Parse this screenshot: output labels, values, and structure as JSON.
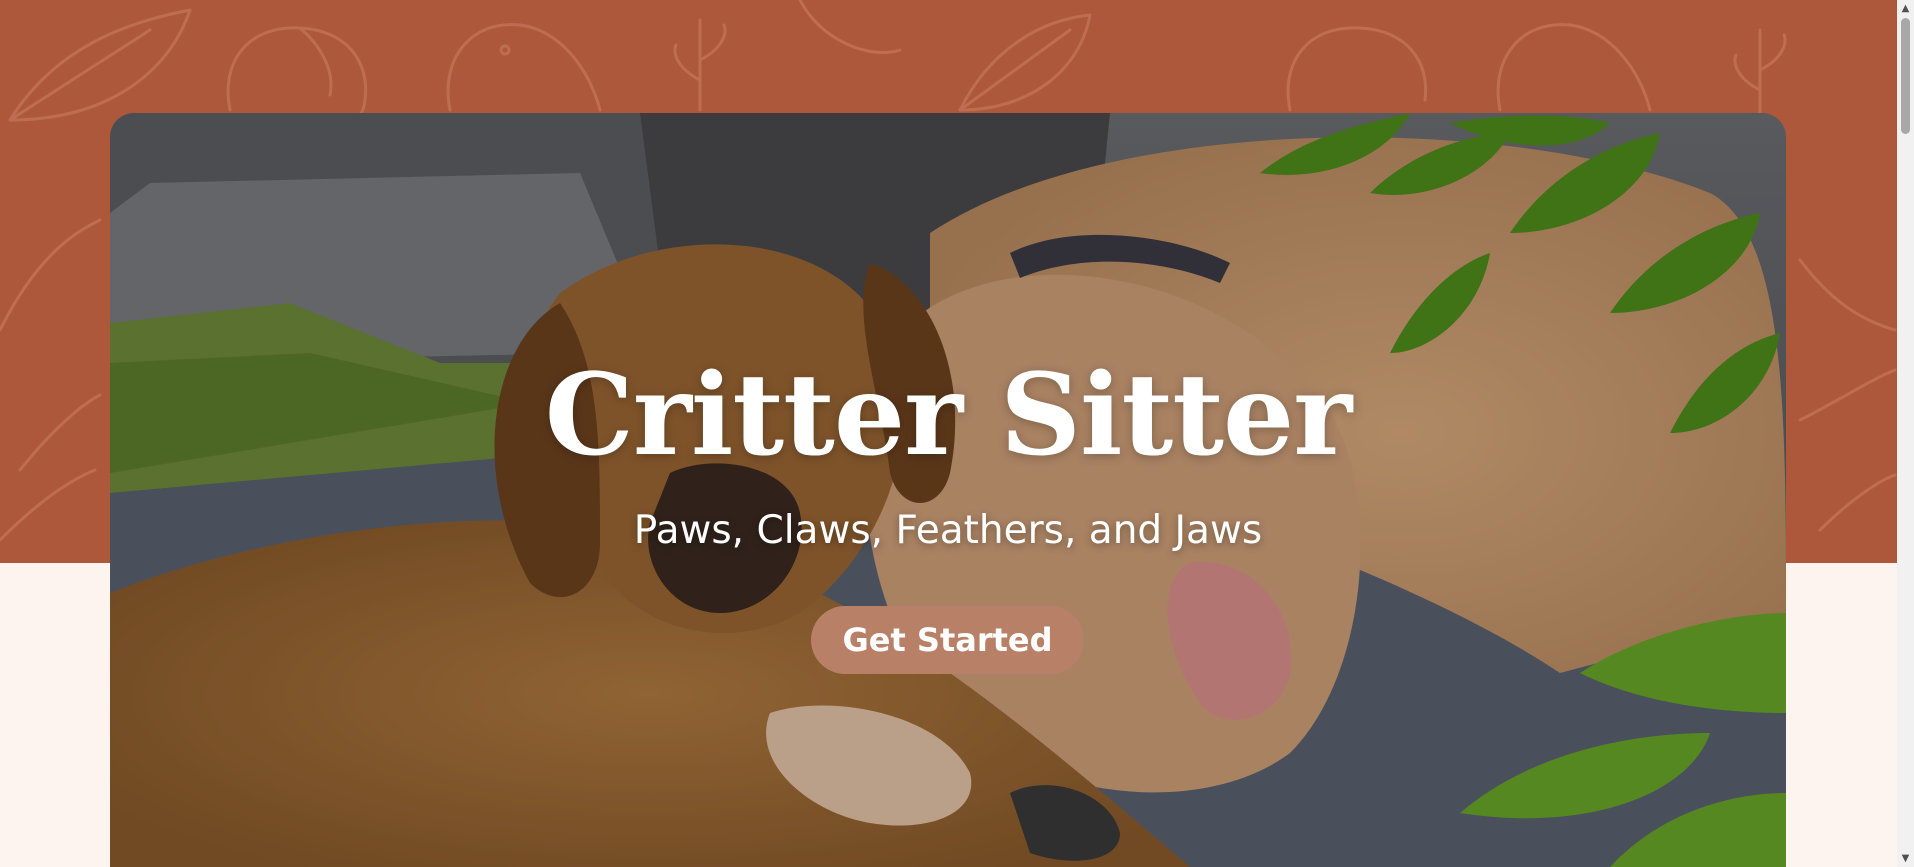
{
  "hero": {
    "title": "Critter Sitter",
    "subtitle": "Paws, Claws, Feathers, and Jaws",
    "cta_label": "Get Started",
    "image_description": "two-dogs-resting-photo"
  },
  "colors": {
    "band": "#ad583a",
    "page_background": "#fdf4f0",
    "cta_background": "#b98068",
    "text": "#ffffff"
  },
  "scrollbar": {
    "up_glyph": "▲",
    "down_glyph": "▼"
  }
}
